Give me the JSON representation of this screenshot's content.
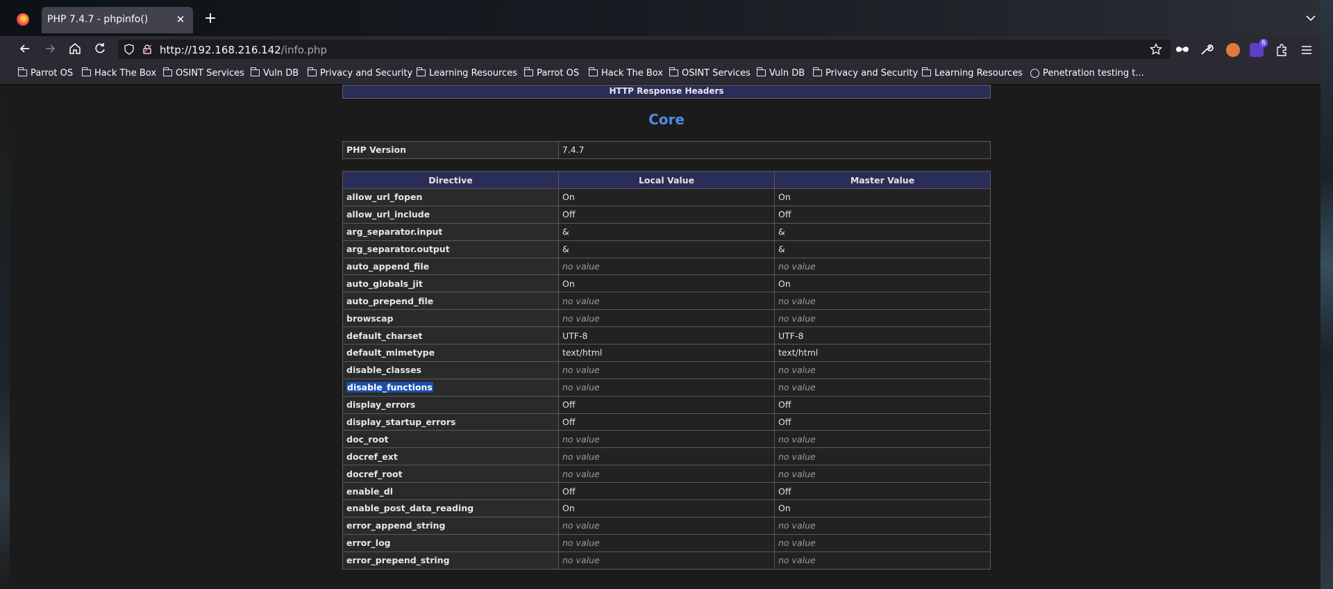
{
  "browser": {
    "tab_title": "PHP 7.4.7 - phpinfo()",
    "url_host": "http://192.168.216.142",
    "url_path": "/info.php",
    "bookmarks": [
      {
        "label": "Parrot OS",
        "icon": "folder-icon"
      },
      {
        "label": "Hack The Box",
        "icon": "folder-icon"
      },
      {
        "label": "OSINT Services",
        "icon": "folder-icon"
      },
      {
        "label": "Vuln DB",
        "icon": "folder-icon"
      },
      {
        "label": "Privacy and Security",
        "icon": "folder-icon"
      },
      {
        "label": "Learning Resources",
        "icon": "folder-icon"
      },
      {
        "label": "Parrot OS",
        "icon": "folder-icon"
      },
      {
        "label": "Hack The Box",
        "icon": "folder-icon"
      },
      {
        "label": "OSINT Services",
        "icon": "folder-icon"
      },
      {
        "label": "Vuln DB",
        "icon": "folder-icon"
      },
      {
        "label": "Privacy and Security",
        "icon": "folder-icon"
      },
      {
        "label": "Learning Resources",
        "icon": "folder-icon"
      },
      {
        "label": "Penetration testing t...",
        "icon": "globe-icon"
      }
    ],
    "extension_badge": "6"
  },
  "page": {
    "prev_section_header": "HTTP Response Headers",
    "section_title": "Core",
    "php_version_label": "PHP Version",
    "php_version_value": "7.4.7",
    "columns": [
      "Directive",
      "Local Value",
      "Master Value"
    ],
    "rows": [
      {
        "directive": "allow_url_fopen",
        "local": "On",
        "master": "On"
      },
      {
        "directive": "allow_url_include",
        "local": "Off",
        "master": "Off"
      },
      {
        "directive": "arg_separator.input",
        "local": "&",
        "master": "&"
      },
      {
        "directive": "arg_separator.output",
        "local": "&",
        "master": "&"
      },
      {
        "directive": "auto_append_file",
        "local": "no value",
        "master": "no value"
      },
      {
        "directive": "auto_globals_jit",
        "local": "On",
        "master": "On"
      },
      {
        "directive": "auto_prepend_file",
        "local": "no value",
        "master": "no value"
      },
      {
        "directive": "browscap",
        "local": "no value",
        "master": "no value"
      },
      {
        "directive": "default_charset",
        "local": "UTF-8",
        "master": "UTF-8"
      },
      {
        "directive": "default_mimetype",
        "local": "text/html",
        "master": "text/html"
      },
      {
        "directive": "disable_classes",
        "local": "no value",
        "master": "no value"
      },
      {
        "directive": "disable_functions",
        "local": "no value",
        "master": "no value",
        "selected": true
      },
      {
        "directive": "display_errors",
        "local": "Off",
        "master": "Off"
      },
      {
        "directive": "display_startup_errors",
        "local": "Off",
        "master": "Off"
      },
      {
        "directive": "doc_root",
        "local": "no value",
        "master": "no value"
      },
      {
        "directive": "docref_ext",
        "local": "no value",
        "master": "no value"
      },
      {
        "directive": "docref_root",
        "local": "no value",
        "master": "no value"
      },
      {
        "directive": "enable_dl",
        "local": "Off",
        "master": "Off"
      },
      {
        "directive": "enable_post_data_reading",
        "local": "On",
        "master": "On"
      },
      {
        "directive": "error_append_string",
        "local": "no value",
        "master": "no value"
      },
      {
        "directive": "error_log",
        "local": "no value",
        "master": "no value"
      },
      {
        "directive": "error_prepend_string",
        "local": "no value",
        "master": "no value"
      }
    ]
  }
}
